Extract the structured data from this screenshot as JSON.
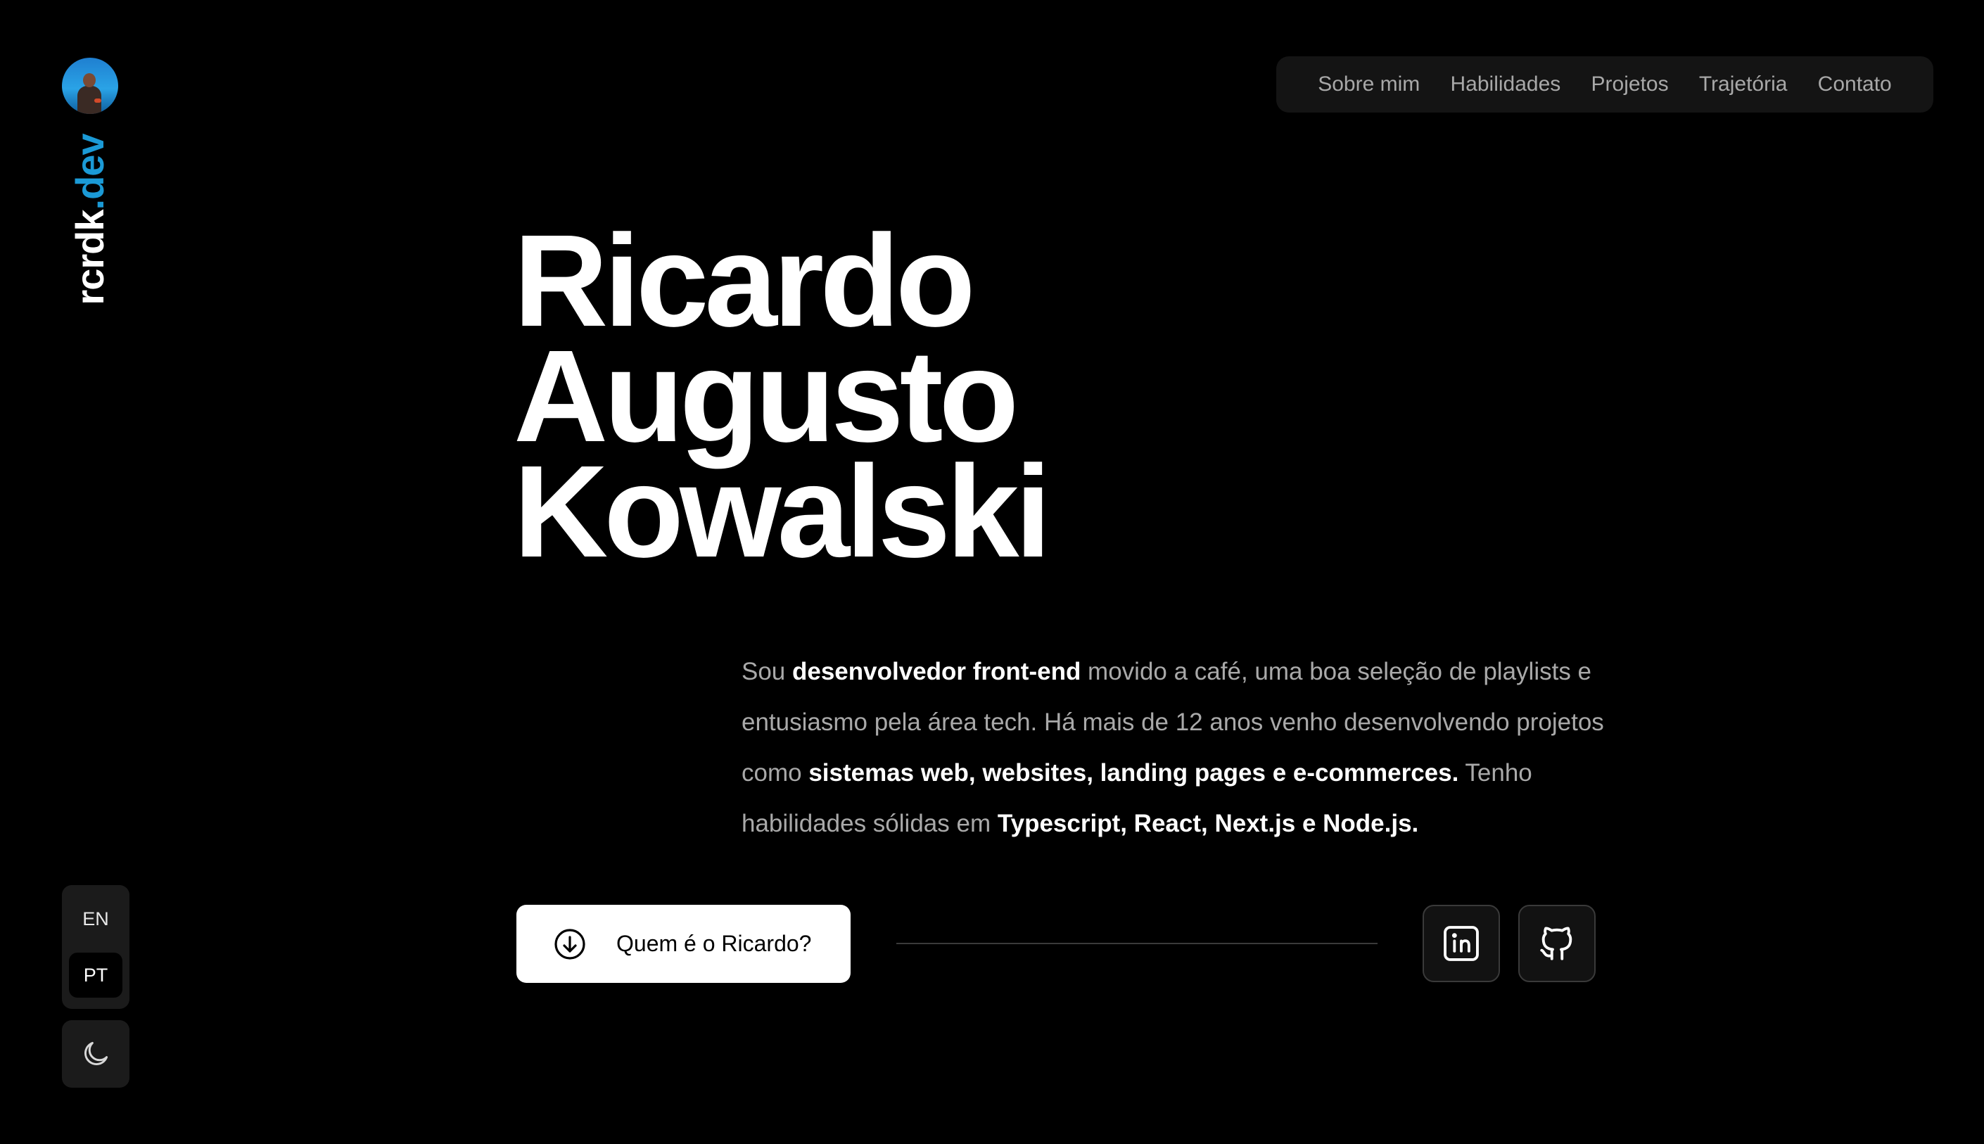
{
  "brand": {
    "logo_name": "rcrdk",
    "logo_tld": ".dev",
    "accent_color": "#1b9ad6"
  },
  "nav": {
    "items": [
      {
        "label": "Sobre mim"
      },
      {
        "label": "Habilidades"
      },
      {
        "label": "Projetos"
      },
      {
        "label": "Trajetória"
      },
      {
        "label": "Contato"
      }
    ]
  },
  "hero": {
    "name_line1": "Ricardo",
    "name_line2": "Augusto",
    "name_line3": "Kowalski"
  },
  "bio": {
    "p1": "Sou ",
    "b1": "desenvolvedor front-end",
    "p2": " movido a café, uma boa seleção de playlists e entusiasmo pela área tech. Há mais de 12 anos venho desenvolvendo projetos como ",
    "b2": "sistemas web, websites, landing pages e e-commerces.",
    "p3": " Tenho habilidades sólidas em ",
    "b3": "Typescript, React, Next.js e Node.js."
  },
  "cta": {
    "label": "Quem é o Ricardo?",
    "icon": "arrow-down-circle-icon"
  },
  "social": {
    "linkedin_icon": "linkedin-icon",
    "github_icon": "github-icon"
  },
  "language": {
    "options": [
      "EN",
      "PT"
    ],
    "selected": "PT"
  },
  "theme": {
    "icon": "moon-icon",
    "mode": "dark"
  }
}
